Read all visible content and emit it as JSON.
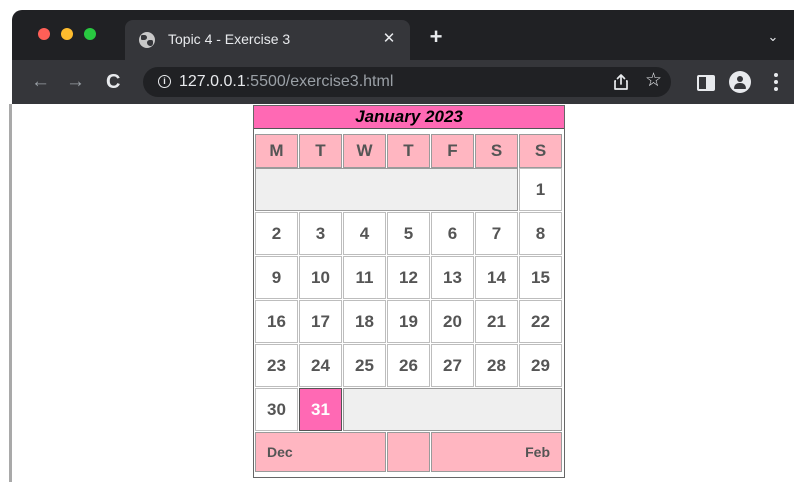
{
  "window": {
    "traffic_lights": [
      "close",
      "minimize",
      "zoom"
    ]
  },
  "tab": {
    "title": "Topic 4 - Exercise 3",
    "close_glyph": "✕",
    "new_tab_glyph": "+",
    "menu_glyph": "⌄"
  },
  "toolbar": {
    "back_glyph": "←",
    "forward_glyph": "→",
    "reload_glyph": "C",
    "url_host": "127.0.0.1",
    "url_path": ":5500/exercise3.html",
    "star_glyph": "☆",
    "info_glyph": "i",
    "icons": [
      "share-icon",
      "bookmark-star-icon",
      "side-panel-icon",
      "profile-avatar-icon",
      "kebab-menu-icon"
    ]
  },
  "calendar": {
    "title": "January 2023",
    "weekdays": [
      "M",
      "T",
      "W",
      "T",
      "F",
      "S",
      "S"
    ],
    "days": [
      "1",
      "2",
      "3",
      "4",
      "5",
      "6",
      "7",
      "8",
      "9",
      "10",
      "11",
      "12",
      "13",
      "14",
      "15",
      "16",
      "17",
      "18",
      "19",
      "20",
      "21",
      "22",
      "23",
      "24",
      "25",
      "26",
      "27",
      "28",
      "29",
      "30",
      "31"
    ],
    "highlighted_day": "31",
    "leading_empty_cells": 6,
    "prev_month": "Dec",
    "next_month": "Feb",
    "colors": {
      "header": "#ff69b4",
      "weekday_cells": "#ffb6c1",
      "highlight": "#ff69b4",
      "empty": "#efefef"
    }
  }
}
